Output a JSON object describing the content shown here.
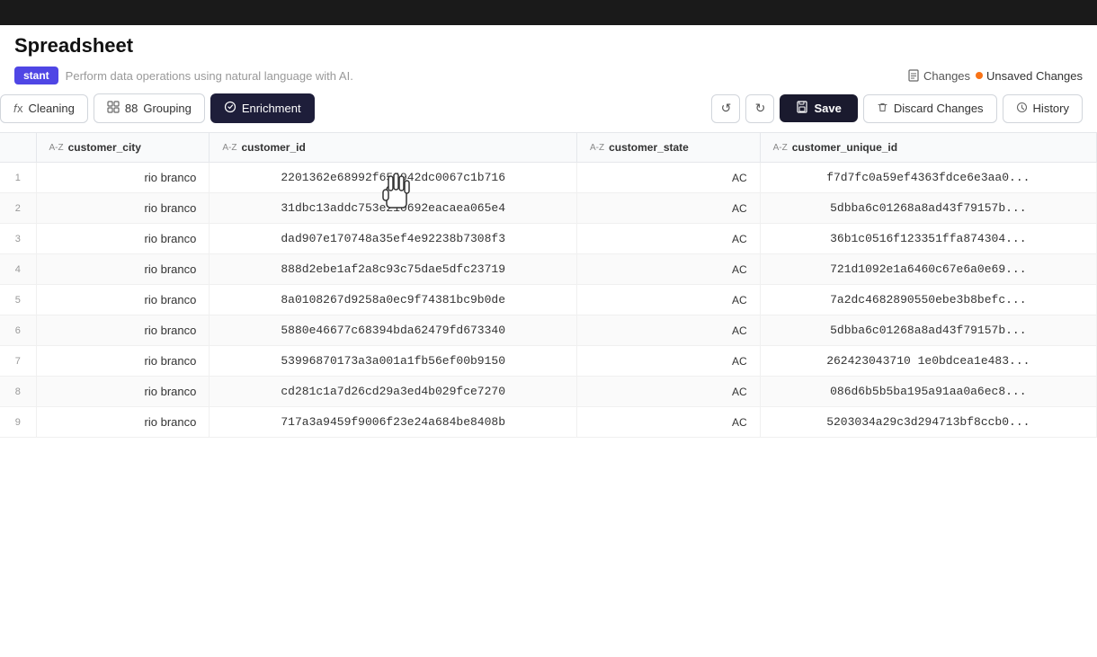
{
  "topbar": {},
  "header": {
    "title": "Spreadsheet"
  },
  "ai_bar": {
    "tag": "stant",
    "placeholder": "Perform data operations using natural language with AI.",
    "changes_label": "Changes",
    "unsaved_label": "Unsaved Changes"
  },
  "toolbar": {
    "cleaning_label": "Cleaning",
    "grouping_label": "Grouping",
    "enrichment_label": "Enrichment",
    "save_label": "Save",
    "discard_label": "Discard Changes",
    "history_label": "History",
    "grouping_count": "88"
  },
  "table": {
    "columns": [
      "customer_city",
      "customer_id",
      "customer_state",
      "customer_unique_id"
    ],
    "rows": [
      [
        "rio branco",
        "2201362e68992f654942dc0067c1b716",
        "AC",
        "f7d7fc0a59ef4363fdce6e3aa0..."
      ],
      [
        "rio branco",
        "31dbc13addc753e210692eacaea065e4",
        "AC",
        "5dbba6c01268a8ad43f79157b..."
      ],
      [
        "rio branco",
        "dad907e170748a35ef4e92238b7308f3",
        "AC",
        "36b1c0516f123351ffa874304..."
      ],
      [
        "rio branco",
        "888d2ebe1af2a8c93c75dae5dfc23719",
        "AC",
        "721d1092e1a6460c67e6a0e69..."
      ],
      [
        "rio branco",
        "8a0108267d9258a0ec9f74381bc9b0de",
        "AC",
        "7a2dc4682890550ebe3b8befc..."
      ],
      [
        "rio branco",
        "5880e46677c68394bda62479fd673340",
        "AC",
        "5dbba6c01268a8ad43f79157b..."
      ],
      [
        "rio branco",
        "53996870173a3a001a1fb56ef00b9150",
        "AC",
        "262423043710 1e0bdcea1e483..."
      ],
      [
        "rio branco",
        "cd281c1a7d26cd29a3ed4b029fce7270",
        "AC",
        "086d6b5b5ba195a91aa0a6ec8..."
      ],
      [
        "rio branco",
        "717a3a9459f9006f23e24a684be8408b",
        "AC",
        "5203034a29c3d294713bf8ccb0..."
      ]
    ]
  }
}
